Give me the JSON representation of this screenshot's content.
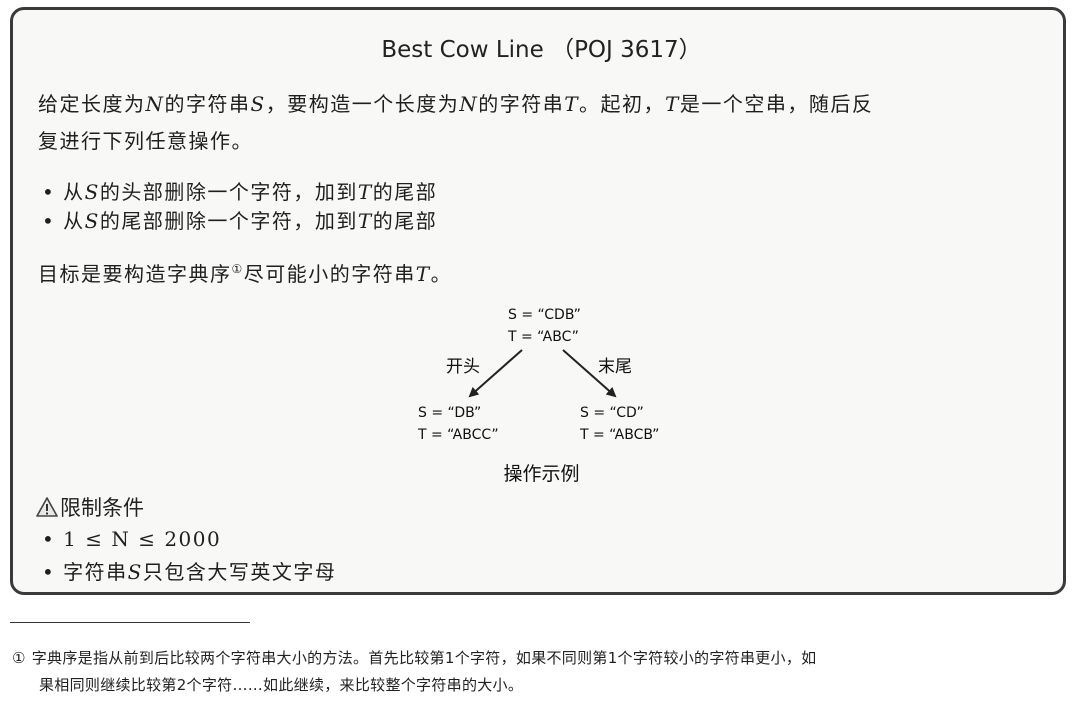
{
  "title": "Best Cow Line （POJ 3617）",
  "intro": {
    "line1_a": "给定长度为",
    "N": "N",
    "line1_b": "的字符串",
    "S": "S",
    "line1_c": "，要构造一个长度为",
    "line1_d": "的字符串",
    "T": "T",
    "line1_e": "。起初，",
    "line1_f": "是一个空串，随后反",
    "line2": "复进行下列任意操作。"
  },
  "operations": [
    {
      "a": "从",
      "b": "的头部删除一个字符，加到",
      "c": "的尾部"
    },
    {
      "a": "从",
      "b": "的尾部删除一个字符，加到",
      "c": "的尾部"
    }
  ],
  "goal": {
    "a": "目标是要构造字典序",
    "note": "①",
    "b": "尽可能小的字符串",
    "end": "。"
  },
  "diagram": {
    "root": {
      "s": "S = “CDB”",
      "t": "T = “ABC”"
    },
    "left_label": "开头",
    "right_label": "末尾",
    "left": {
      "s": "S = “DB”",
      "t": "T = “ABCC”"
    },
    "right": {
      "s": "S = “CD”",
      "t": "T = “ABCB”"
    },
    "caption": "操作示例"
  },
  "constraints": {
    "heading": "限制条件",
    "items": [
      {
        "text": "1 ≤ N ≤ 2000"
      },
      {
        "a": "字符串",
        "b": "只包含大写英文字母"
      }
    ],
    "icon": "warning-icon"
  },
  "footnote": {
    "mark": "①",
    "line1": "字典序是指从前到后比较两个字符串大小的方法。首先比较第1个字符，如果不同则第1个字符较小的字符串更小，如",
    "line2": "果相同则继续比较第2个字符……如此继续，来比较整个字符串的大小。"
  }
}
